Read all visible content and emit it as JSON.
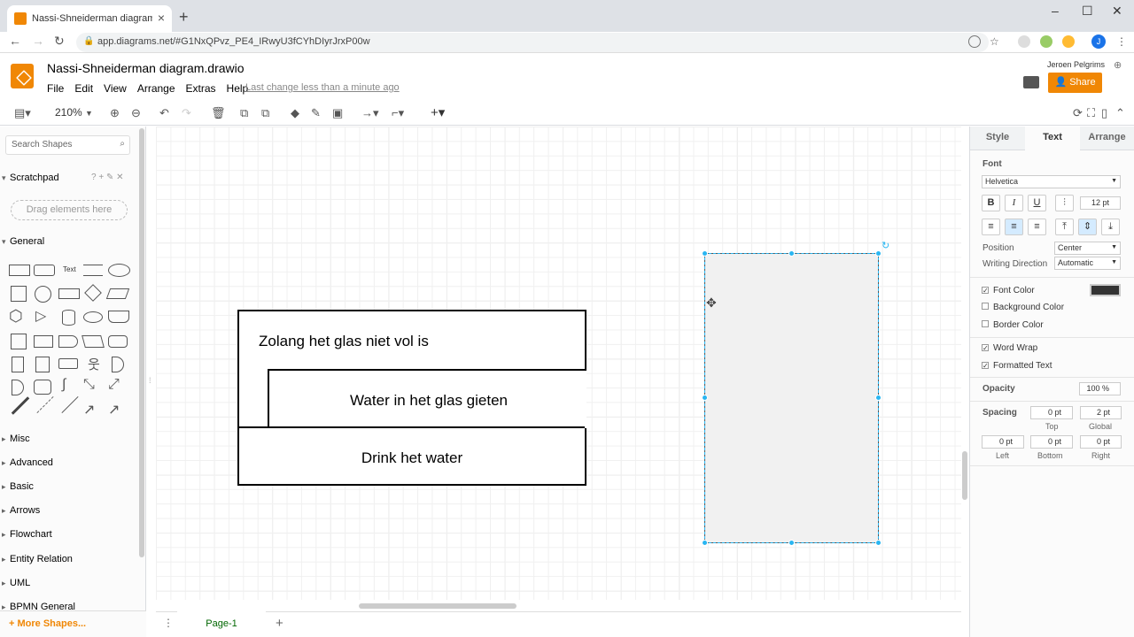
{
  "browser": {
    "tab_title": "Nassi-Shneiderman diagram.drawio",
    "url": "app.diagrams.net/#G1NxQPvz_PE4_IRwyU3fCYhDIyrJrxP00w",
    "minimize": "–",
    "maximize": "☐",
    "close": "✕",
    "avatar": "J"
  },
  "app": {
    "title": "Nassi-Shneiderman diagram.drawio",
    "menu": [
      "File",
      "Edit",
      "View",
      "Arrange",
      "Extras",
      "Help"
    ],
    "last_change": "Last change less than a minute ago",
    "user": "Jeroen Pelgrims",
    "share": "Share",
    "accent": "#f08705"
  },
  "toolbar": {
    "zoom": "210%"
  },
  "sidebar": {
    "search_placeholder": "Search Shapes",
    "scratchpad": "Scratchpad",
    "scratchpad_tools": "? + ✎ ✕",
    "drag_hint": "Drag elements here",
    "sections": [
      "General",
      "Misc",
      "Advanced",
      "Basic",
      "Arrows",
      "Flowchart",
      "Entity Relation",
      "UML",
      "BPMN General"
    ],
    "more_shapes": "+ More Shapes..."
  },
  "canvas": {
    "loop_condition": "Zolang het glas niet vol is",
    "loop_body": "Water in het glas gieten",
    "after_loop": "Drink het water"
  },
  "pages": {
    "current": "Page-1"
  },
  "format_panel": {
    "tabs": [
      "Style",
      "Text",
      "Arrange"
    ],
    "active_tab": "Text",
    "font_label": "Font",
    "font_family": "Helvetica",
    "font_size": "12 pt",
    "position_label": "Position",
    "position_value": "Center",
    "writing_direction_label": "Writing Direction",
    "writing_direction_value": "Automatic",
    "font_color_label": "Font Color",
    "background_color_label": "Background Color",
    "border_color_label": "Border Color",
    "word_wrap_label": "Word Wrap",
    "formatted_text_label": "Formatted Text",
    "opacity_label": "Opacity",
    "opacity_value": "100 %",
    "spacing_label": "Spacing",
    "spacing_top": "0 pt",
    "spacing_global": "2 pt",
    "spacing_left": "0 pt",
    "spacing_bottom": "0 pt",
    "spacing_right": "0 pt",
    "top_label": "Top",
    "global_label": "Global",
    "left_label": "Left",
    "bottom_label": "Bottom",
    "right_label": "Right",
    "font_color": "#333333"
  }
}
